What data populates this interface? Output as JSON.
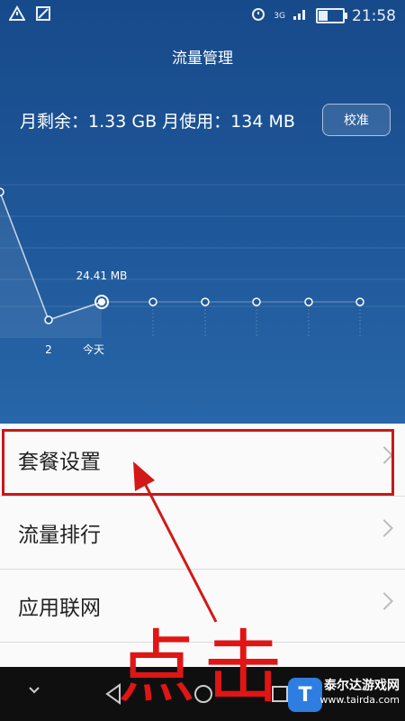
{
  "status_bar": {
    "time": "21:58",
    "network": "3G"
  },
  "header": {
    "title": "流量管理"
  },
  "summary": {
    "text": "月剩余：1.33 GB 月使用：134 MB"
  },
  "calibrate_button": {
    "label": "校准"
  },
  "chart_data": {
    "type": "line",
    "x": [
      "",
      "2",
      "今天",
      "",
      "",
      "",
      "",
      ""
    ],
    "values": [
      null,
      null,
      24.41,
      null,
      null,
      null,
      null,
      null
    ],
    "today_label": "24.41 MB",
    "x_label_day2": "2",
    "x_label_today": "今天"
  },
  "menu": {
    "items": [
      {
        "label": "套餐设置"
      },
      {
        "label": "流量排行"
      },
      {
        "label": "应用联网"
      }
    ]
  },
  "annotation": {
    "text": "点击"
  },
  "watermark": {
    "line1": "泰尔达游戏网",
    "line2": "www.tairda.com"
  }
}
